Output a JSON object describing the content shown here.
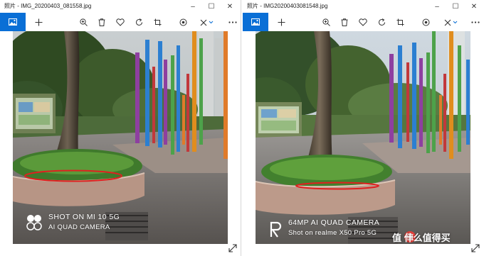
{
  "left_window": {
    "app_name": "照片",
    "file_name": "IMG_20200403_081558.jpg",
    "title": "照片 - IMG_20200403_081558.jpg",
    "watermark": {
      "line1": "SHOT ON MI 10 5G",
      "line2": "AI QUAD CAMERA"
    }
  },
  "right_window": {
    "app_name": "照片",
    "file_name": "IMG20200403081548.jpg",
    "title": "照片 - IMG20200403081548.jpg",
    "watermark": {
      "line1": "64MP AI QUAD CAMERA",
      "line2": "Shot on realme X50 Pro 5G"
    }
  },
  "site_watermark": "值 什么值得买",
  "window_controls": {
    "minimize": "–",
    "maximize": "☐",
    "close": "✕"
  },
  "toolbar_icons": [
    "image-view-icon",
    "add-icon",
    "zoom-icon",
    "delete-icon",
    "favorite-icon",
    "rotate-icon",
    "crop-icon",
    "enhance-icon",
    "edit-icon",
    "more-icon"
  ],
  "colors": {
    "accent": "#0a6fd6",
    "annotation": "#e02020"
  }
}
